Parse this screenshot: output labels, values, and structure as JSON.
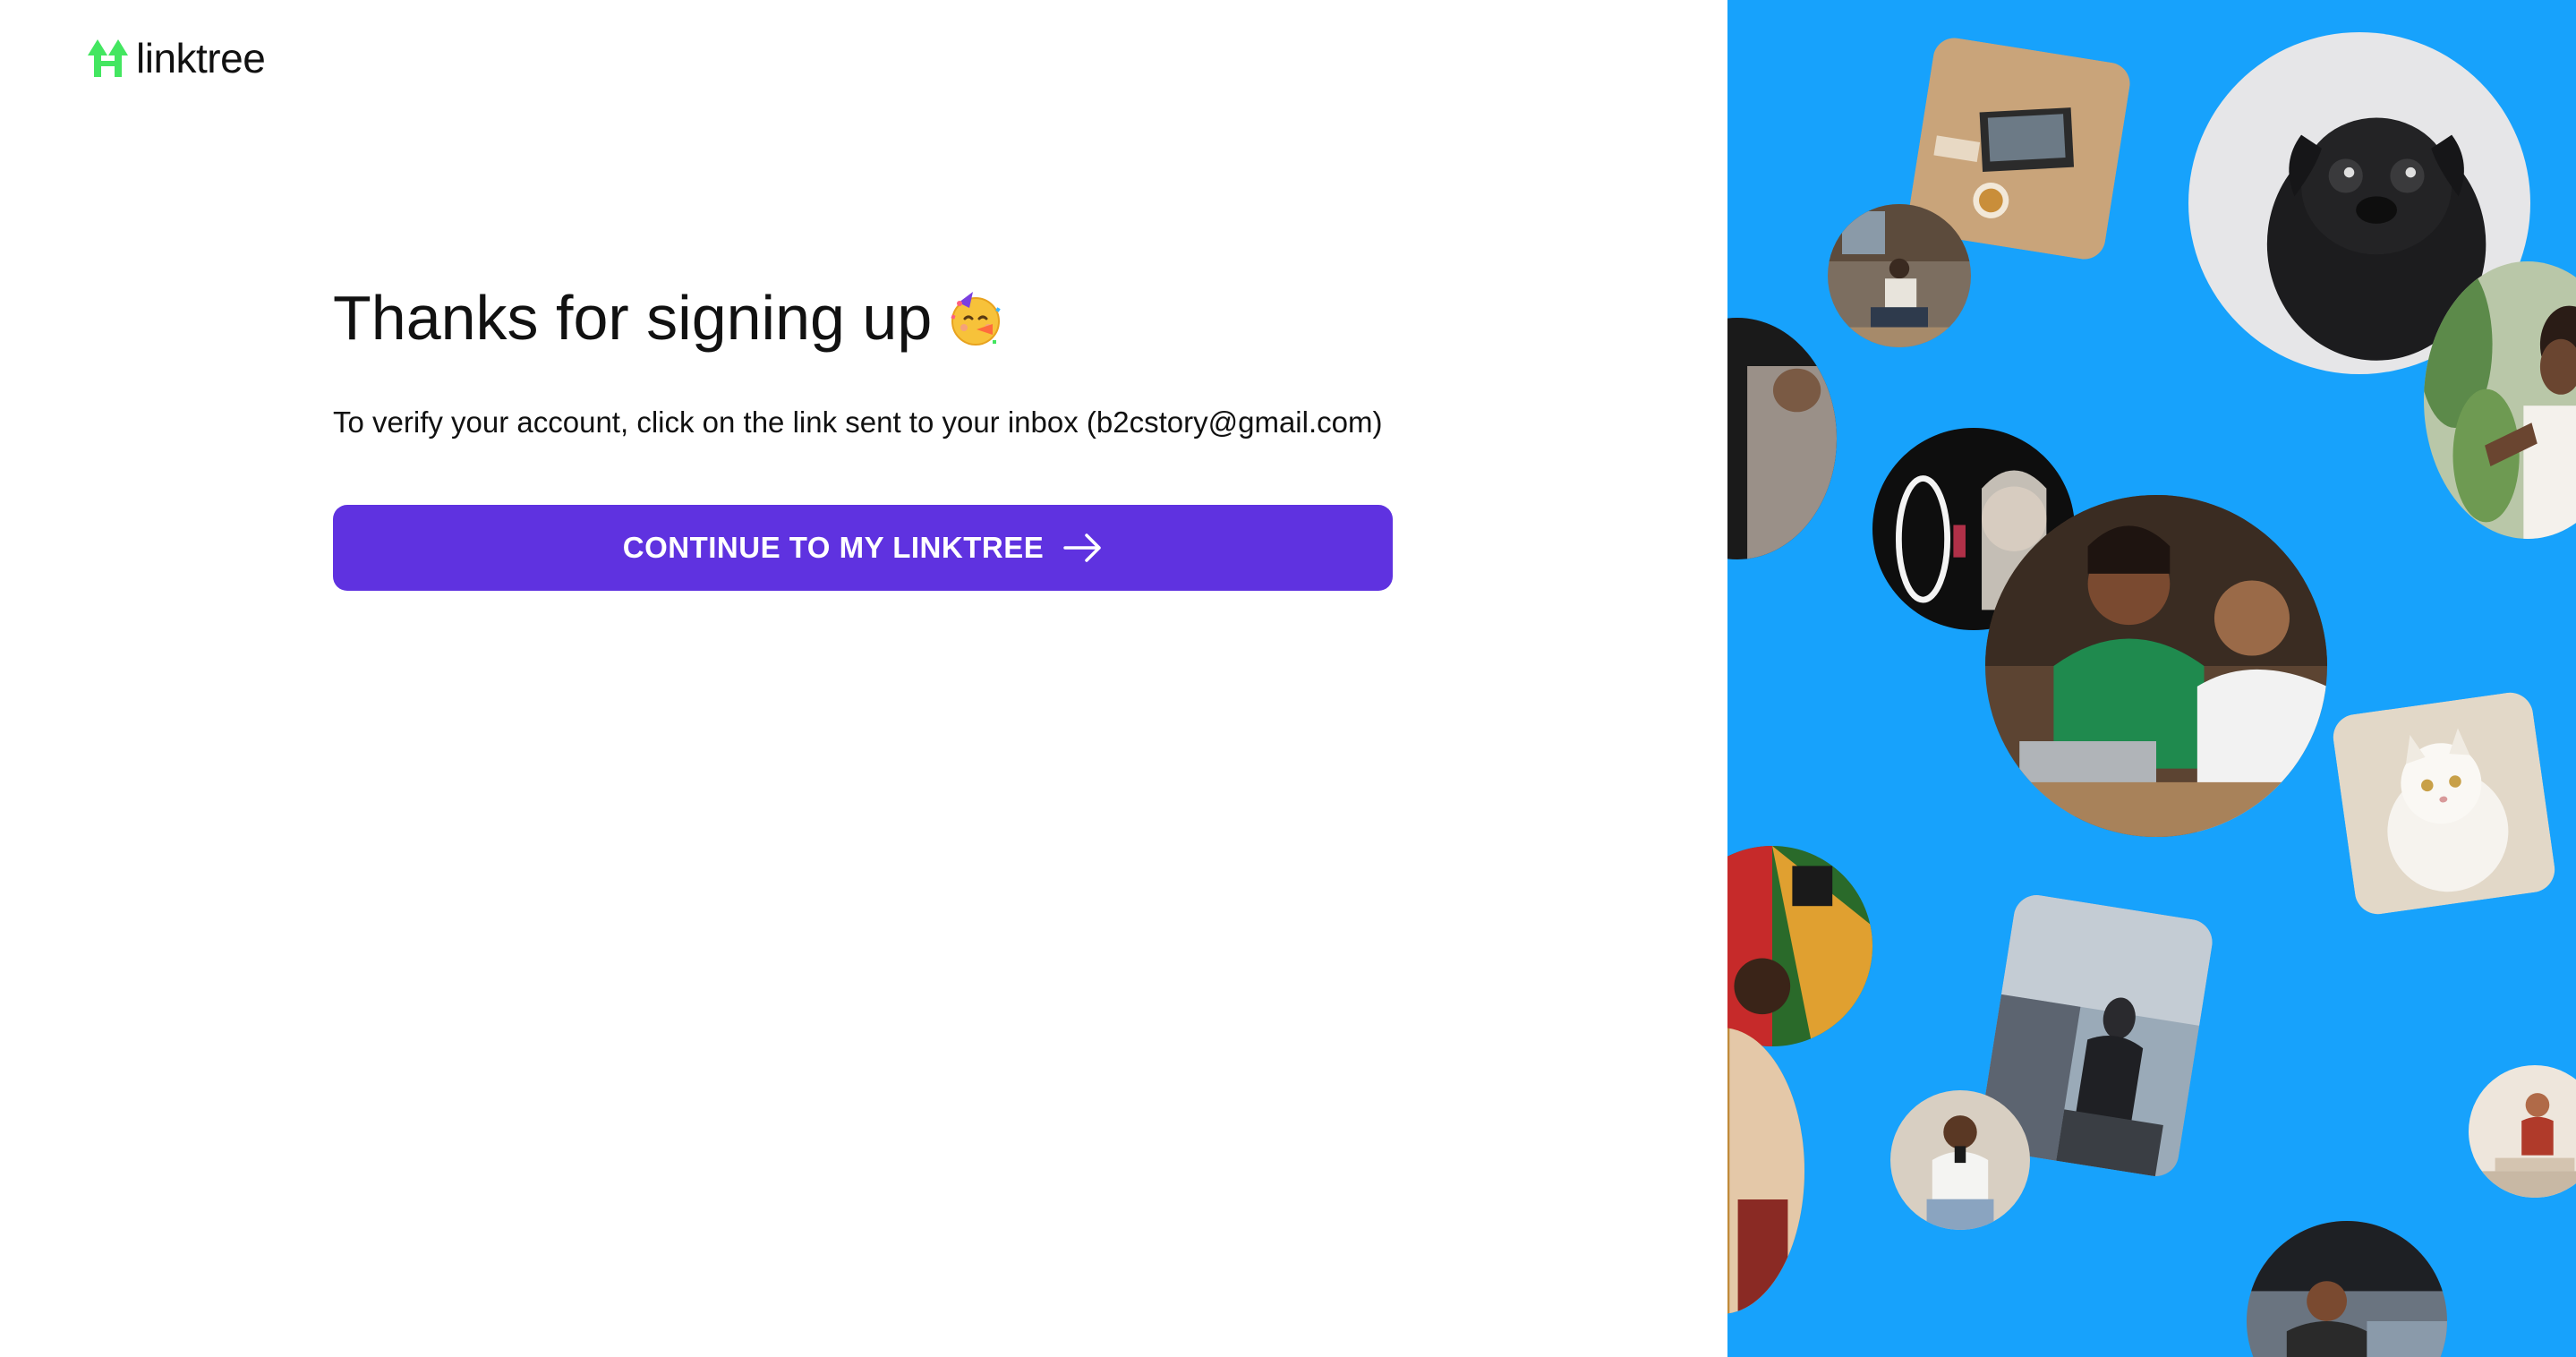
{
  "brand": {
    "name": "linktree",
    "logo_icon": "linktree-tree-icon",
    "accent_color": "#43e660"
  },
  "main": {
    "headline": "Thanks for signing up",
    "headline_emoji": "partying-face-icon",
    "message": "To verify your account, click on the link sent to your inbox (b2cstory@gmail.com)",
    "cta_label": "CONTINUE TO MY LINKTREE",
    "cta_icon": "arrow-right-icon",
    "cta_color": "#5f32e0"
  },
  "panel": {
    "background_color": "#17a2fc",
    "images": [
      "laptop-desk-photo",
      "pug-dog-photo",
      "woman-reading-photo",
      "woman-phone-plants-photo",
      "partial-portrait-photo",
      "ring-light-makeup-photo",
      "couple-laptop-photo",
      "white-cat-photo",
      "colorful-fabric-photo",
      "man-sitting-steps-photo",
      "partial-person-photo",
      "man-phone-outdoors-photo",
      "yoga-woman-photo",
      "street-sitting-photo"
    ]
  }
}
